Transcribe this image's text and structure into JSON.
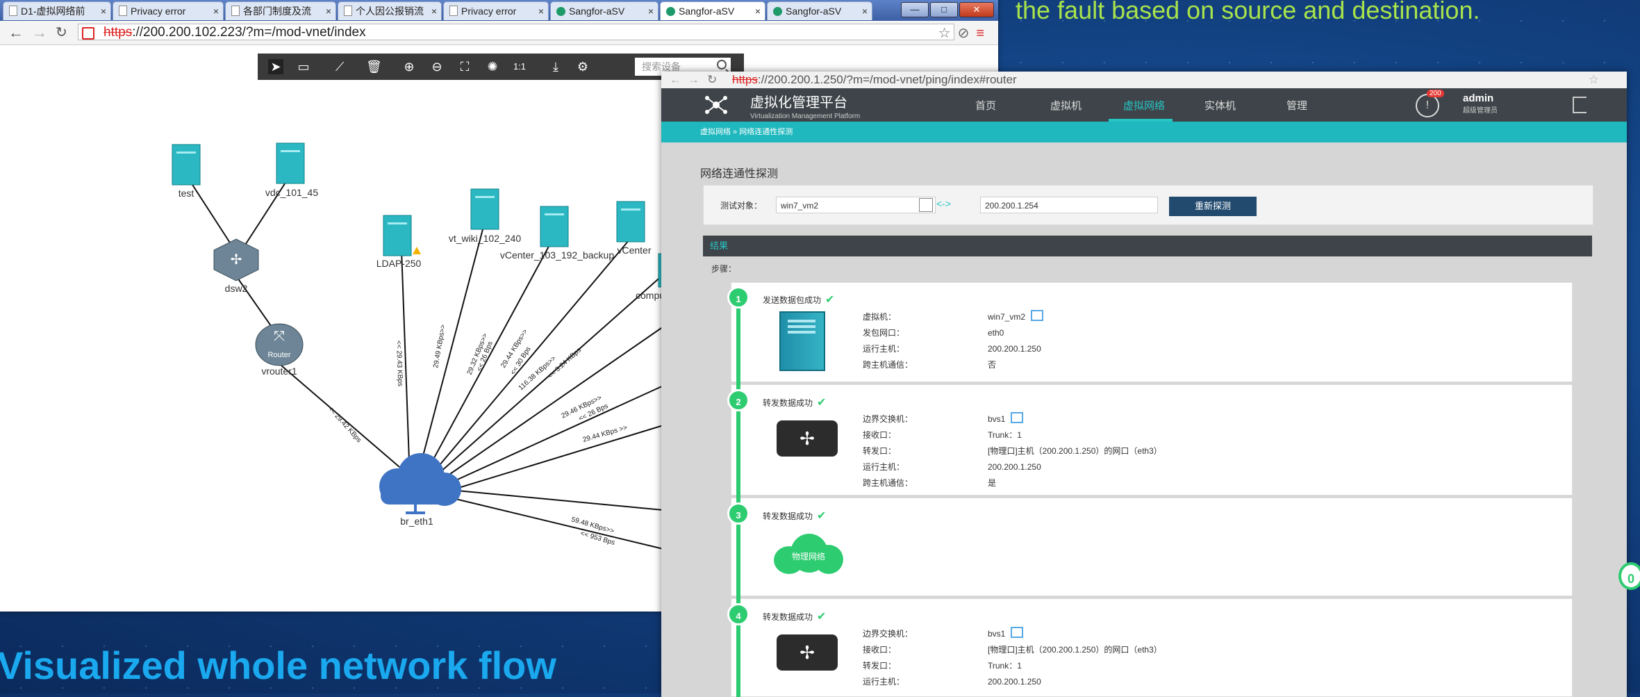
{
  "promo": {
    "top_text": "the fault based on source and destination.",
    "bottom_text": "Visualized whole network flow"
  },
  "left_browser": {
    "tabs": [
      {
        "label": "D1-虚拟网络前"
      },
      {
        "label": "Privacy error"
      },
      {
        "label": "各部门制度及流"
      },
      {
        "label": "个人因公报销流"
      },
      {
        "label": "Privacy error"
      },
      {
        "label": "Sangfor-aSV"
      },
      {
        "label": "Sangfor-aSV"
      },
      {
        "label": "Sangfor-aSV"
      }
    ],
    "url_https": "https",
    "url_rest": "://200.200.102.223/?m=/mod-vnet/index",
    "window_buttons": {
      "minimize": "—",
      "maximize": "□",
      "close": "✕"
    },
    "toolbar": {
      "zoom_reset": "1:1",
      "search_placeholder": "搜索设备"
    },
    "topology": {
      "nodes": {
        "test": "test",
        "vdc": "vdc_101_45",
        "dsw2": "dsw2",
        "router_icon": "Router",
        "vrouter1": "vrouter1",
        "ldap": "LDAP-250",
        "vt_wiki": "vt_wiki_102_240",
        "vcenter_backup": "vCenter_103_192_backup",
        "vcenter": "vCenter",
        "compute": "compu",
        "br_eth1": "br_eth1"
      },
      "flows": [
        "<< 29.42 KBps",
        "<< 29.43 KBps",
        "29.49 KBps>>",
        "29.32 KBps>>",
        "<< 26 Bps",
        "29.44 KBps>>",
        "<< 30 Bps",
        "116.38 KBps>>",
        "<< 3.24 KBps",
        "29.46 KBps>>",
        "<< 26 Bps",
        "29.44 KBps >>",
        "59.48 KBps>>",
        "<< 953 Bps"
      ]
    }
  },
  "right_browser": {
    "url_https": "https",
    "url_rest": "://200.200.1.250/?m=/mod-vnet/ping/index#router",
    "brand_title": "虚拟化管理平台",
    "brand_sub": "Virtualization Management Platform",
    "nav": [
      "首页",
      "虚拟机",
      "虚拟网络",
      "实体机",
      "管理"
    ],
    "badge": "200",
    "user_name": "admin",
    "user_role": "超级管理员",
    "breadcrumb": "虚拟网络 » 网络连通性探测",
    "page_title": "网络连通性探测",
    "form": {
      "label": "测试对象：",
      "source": "win7_vm2",
      "arrow": "<->",
      "destination": "200.200.1.254",
      "button": "重新探测"
    },
    "result_title": "结果",
    "steps_label": "步骤：",
    "steps": [
      {
        "num": "1",
        "title": "发送数据包成功",
        "fields": [
          {
            "k": "虚拟机：",
            "v": "win7_vm2"
          },
          {
            "k": "发包网口：",
            "v": "eth0"
          },
          {
            "k": "运行主机：",
            "v": "200.200.1.250"
          },
          {
            "k": "跨主机通信：",
            "v": "否"
          }
        ]
      },
      {
        "num": "2",
        "title": "转发数据成功",
        "fields": [
          {
            "k": "边界交换机：",
            "v": "bvs1"
          },
          {
            "k": "接收口：",
            "v": "Trunk：1"
          },
          {
            "k": "转发口：",
            "v": "[物理口]主机（200.200.1.250）的网口（eth3）"
          },
          {
            "k": "运行主机：",
            "v": "200.200.1.250"
          },
          {
            "k": "跨主机通信：",
            "v": "是"
          }
        ]
      },
      {
        "num": "3",
        "title": "转发数据成功",
        "cloud_label": "物理网络",
        "fields": []
      },
      {
        "num": "4",
        "title": "转发数据成功",
        "fields": [
          {
            "k": "边界交换机：",
            "v": "bvs1"
          },
          {
            "k": "接收口：",
            "v": "[物理口]主机（200.200.1.250）的网口（eth3）"
          },
          {
            "k": "转发口：",
            "v": "Trunk：1"
          },
          {
            "k": "运行主机：",
            "v": "200.200.1.250"
          }
        ]
      }
    ],
    "side_bubble": "0"
  }
}
